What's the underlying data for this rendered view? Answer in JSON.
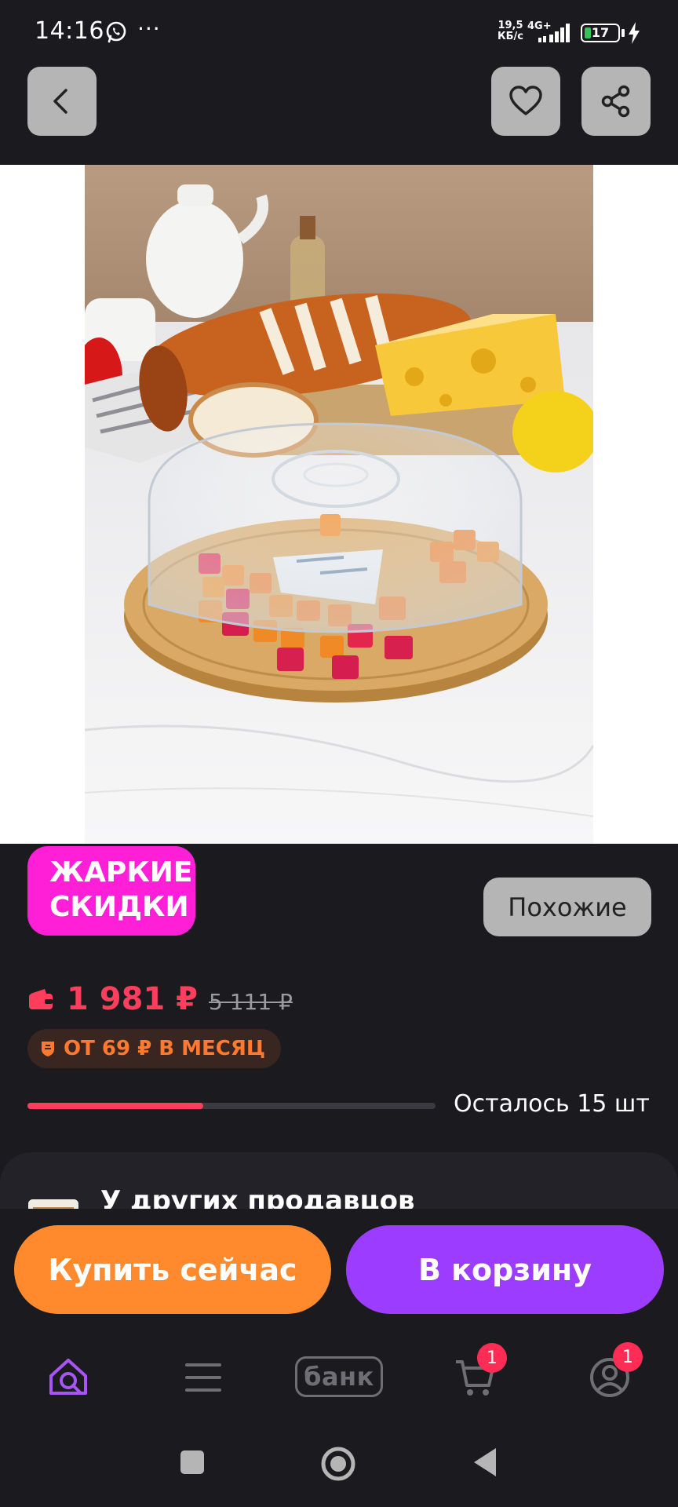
{
  "status_bar": {
    "time": "14:16",
    "more": "···",
    "speed_line1": "19,5",
    "speed_line2": "КБ/с",
    "network": "4G+",
    "battery": "17",
    "icons": [
      "whatsapp-icon",
      "signal-icon",
      "battery-icon",
      "charging-icon"
    ]
  },
  "top_bar": {
    "icons": [
      "chevron-left-icon",
      "heart-icon",
      "share-icon"
    ]
  },
  "product": {
    "image_icon": "product-photo",
    "hot_deal_line1": "ЖАРКИЕ",
    "hot_deal_line2": "СКИДКИ",
    "similar_label": "Похожие",
    "price": "1 981 ₽",
    "old_price": "5 111 ₽",
    "installment": "ОТ 69 ₽ В МЕСЯЦ",
    "stock_label": "Осталось 15 шт",
    "stock_fraction": 0.43
  },
  "other_sellers": {
    "title": "У других продавцов"
  },
  "actions": {
    "buy_now": "Купить сейчас",
    "add_to_cart": "В корзину"
  },
  "bottom_nav": {
    "bank_label": "банк",
    "cart_badge": "1",
    "profile_badge": "1",
    "icons": [
      "home-search-icon",
      "menu-icon",
      "bank-icon",
      "cart-icon",
      "profile-icon"
    ]
  },
  "colors": {
    "background": "#1b1a1f",
    "hot_badge": "#ff1fd6",
    "price": "#ff3d5d",
    "buy_now": "#ff8a2e",
    "add_to_cart": "#9b3cff",
    "installment_text": "#ff7a30",
    "active_nav": "#a855f7"
  }
}
